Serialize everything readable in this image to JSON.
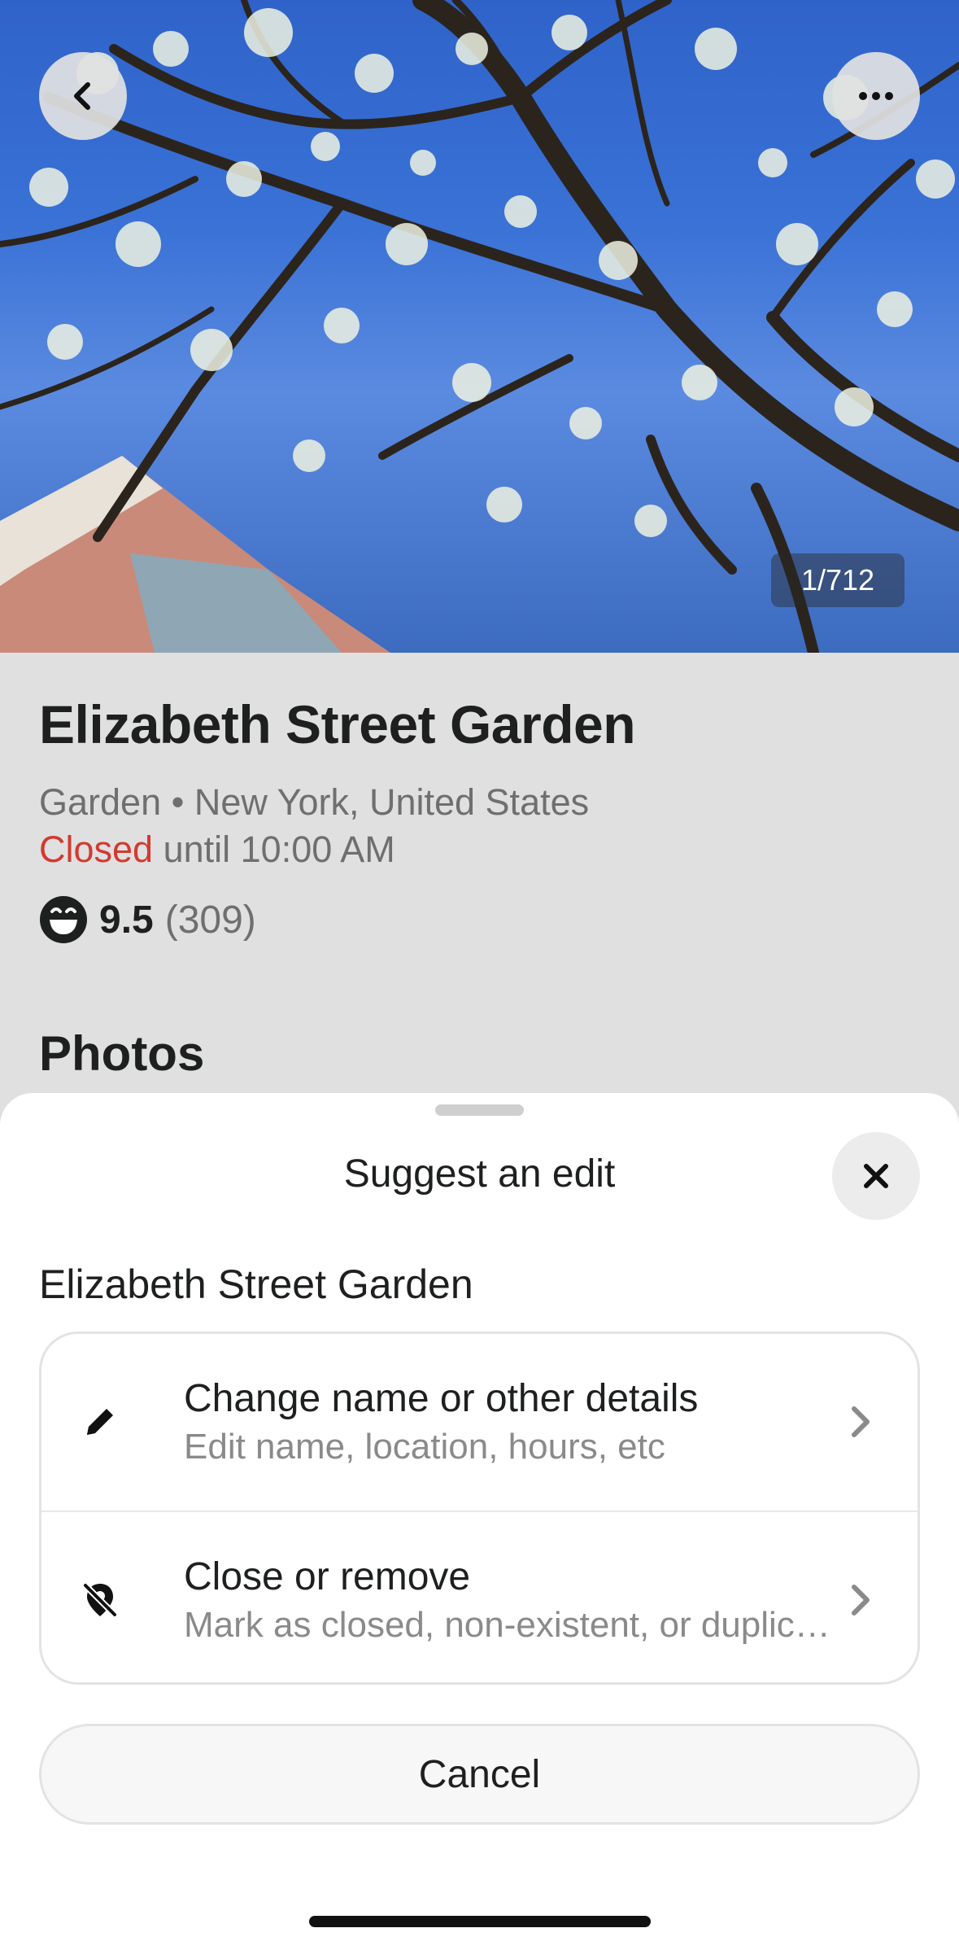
{
  "hero": {
    "photo_counter": "1/712",
    "back_icon": "chevron-left-icon",
    "more_icon": "ellipsis-icon"
  },
  "place": {
    "name": "Elizabeth Street Garden",
    "category_location": "Garden • New York, United States",
    "status": "Closed",
    "status_detail": " until 10:00 AM",
    "rating_icon": "grin-face-icon",
    "rating": "9.5",
    "rating_count": "(309)",
    "photos_heading": "Photos"
  },
  "sheet": {
    "title": "Suggest an edit",
    "place_name": "Elizabeth Street Garden",
    "options": [
      {
        "icon": "pencil-icon",
        "title": "Change name or other details",
        "subtitle": "Edit name, location, hours, etc"
      },
      {
        "icon": "location-off-icon",
        "title": "Close or remove",
        "subtitle": "Mark as closed, non-existent, or duplicate"
      }
    ],
    "cancel_label": "Cancel"
  },
  "colors": {
    "status_closed": "#d23a2f",
    "sky": "#3a72d6"
  }
}
